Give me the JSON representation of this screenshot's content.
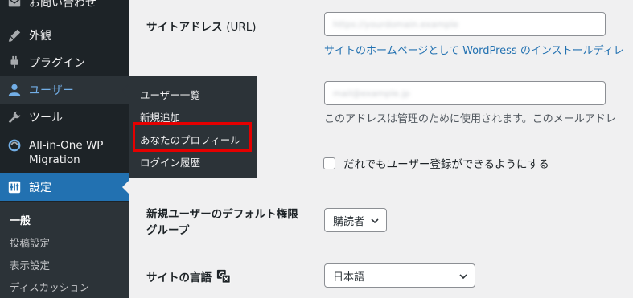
{
  "sidebar": {
    "items": [
      {
        "label": "お問い合わせ",
        "icon": "mail-icon"
      },
      {
        "label": "外観",
        "icon": "brush-icon"
      },
      {
        "label": "プラグイン",
        "icon": "plugin-icon"
      },
      {
        "label": "ユーザー",
        "icon": "user-icon"
      },
      {
        "label": "ツール",
        "icon": "wrench-icon"
      },
      {
        "label": "All-in-One WP Migration",
        "label_line1": "All-in-One WP",
        "label_line2": "Migration",
        "icon": "migration-icon"
      },
      {
        "label": "設定",
        "icon": "settings-icon"
      }
    ],
    "settings_submenu": [
      "一般",
      "投稿設定",
      "表示設定",
      "ディスカッション"
    ]
  },
  "users_flyout": {
    "items": [
      "ユーザー一覧",
      "新規追加",
      "あなたのプロフィール",
      "ログイン履歴"
    ],
    "highlighted": "あなたのプロフィール"
  },
  "form": {
    "site_url": {
      "label": "サイトアドレス",
      "label_suffix": "(URL)",
      "value": "https://yourdomain.example",
      "description_link": "サイトのホームページとして WordPress のインストールディレ"
    },
    "admin_email": {
      "value": "mail@example.jp",
      "description": "このアドレスは管理のために使用されます。このメールアドレ"
    },
    "membership": {
      "checkbox_label": "だれでもユーザー登録ができるようにする",
      "checked": false
    },
    "default_role": {
      "label_line1": "新規ユーザーのデフォルト権限",
      "label_line2": "グループ",
      "value": "購読者"
    },
    "site_language": {
      "label": "サイトの言語",
      "value": "日本語"
    }
  },
  "colors": {
    "sidebar_bg": "#1d2327",
    "active_blue": "#2271b1",
    "highlight_red": "#e50000"
  }
}
